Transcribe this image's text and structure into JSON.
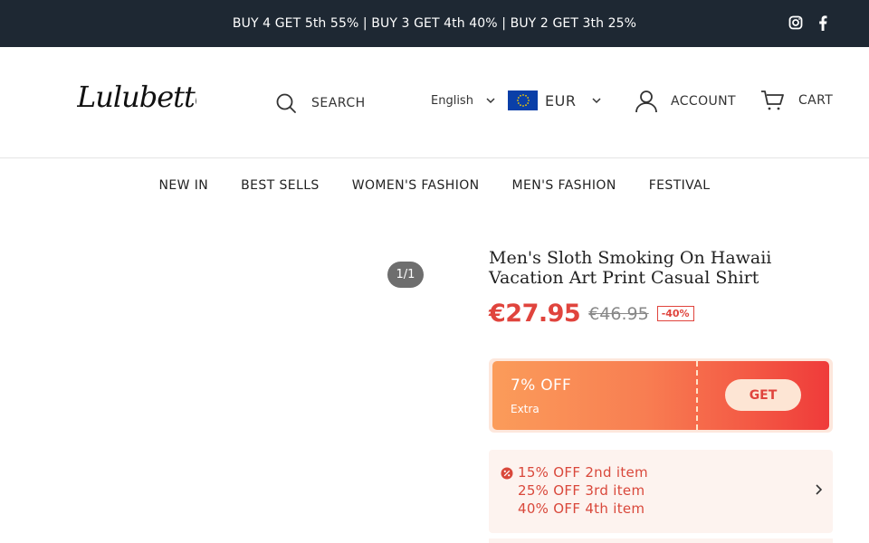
{
  "topbar": {
    "promo": "BUY 4 GET 5th 55% | BUY 3 GET 4th 40% | BUY 2 GET 3th 25%",
    "social": [
      "instagram-icon",
      "facebook-icon"
    ],
    "background": "#1e2833"
  },
  "header": {
    "logo_text": "Lulubette",
    "search_label": "SEARCH",
    "language": "English",
    "currency": "EUR",
    "account_label": "ACCOUNT",
    "cart_label": "CART"
  },
  "nav": {
    "items": [
      "NEW IN",
      "BEST SELLS",
      "WOMEN'S FASHION",
      "MEN'S FASHION",
      "FESTIVAL"
    ]
  },
  "gallery": {
    "pager": "1/1"
  },
  "product": {
    "title": "Men's Sloth Smoking On Hawaii Vacation Art Print Casual Shirt",
    "price": "€27.95",
    "compare_price": "€46.95",
    "discount": "-40%",
    "accent_color": "#e0443d"
  },
  "coupon": {
    "percent": "7% OFF",
    "sub": "Extra",
    "button": "GET"
  },
  "bulk": {
    "lines": [
      "15% OFF 2nd item",
      "25% OFF 3rd item",
      "40% OFF 4th item"
    ]
  }
}
